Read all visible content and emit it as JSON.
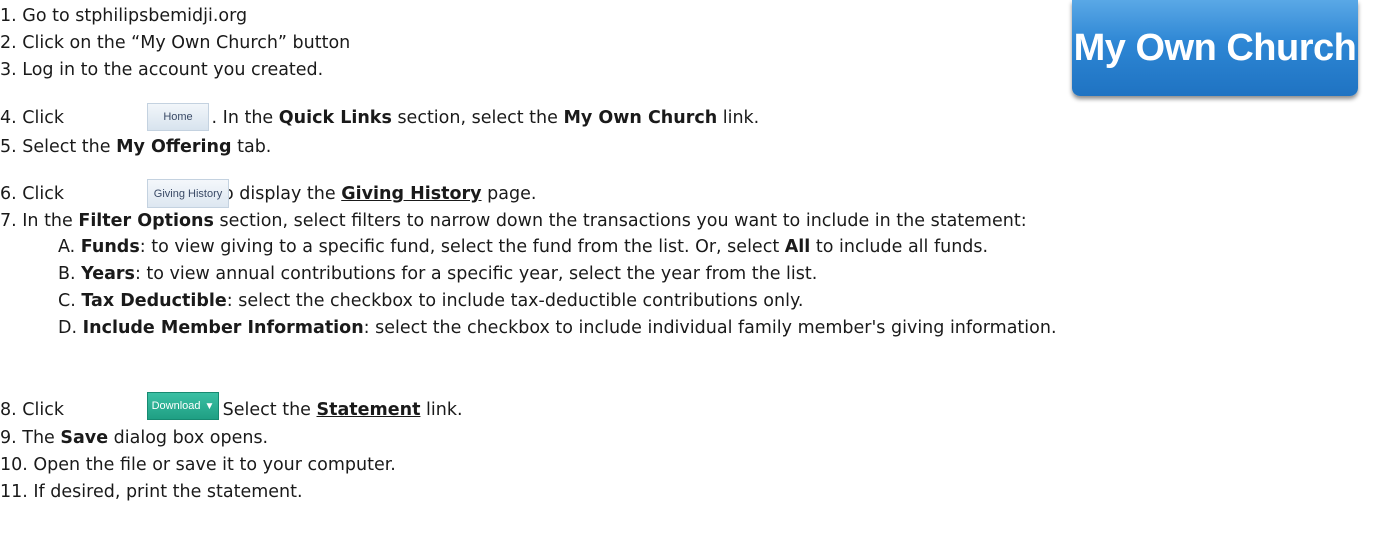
{
  "banner_button": "My Own Church",
  "home_button": "Home",
  "giving_history_button": "Giving History",
  "download_button": "Download",
  "download_arrow": "▼",
  "steps": {
    "s1": "1. Go to stphilipsbemidji.org",
    "s2": "2. Click on the “My Own Church” button",
    "s3": "3. Log in to the account you created.",
    "s4": {
      "a": "4. Click ",
      "b": ". In the ",
      "c": "Quick Links",
      "d": " section, select the ",
      "e": "My Own Church",
      "f": " link."
    },
    "s5": {
      "a": "5. Select the ",
      "b": "My Offering",
      "c": " tab."
    },
    "s6": {
      "a": "6. Click ",
      "b": " to display the ",
      "c": "Giving History",
      "d": " page."
    },
    "s7": {
      "a": "7. In the ",
      "b": "Filter Options",
      "c": " section, select filters to narrow down the transactions you want to include in the statement:"
    },
    "s7a": {
      "a": "A. ",
      "b": "Funds",
      "c": ": to view giving to a specific fund, select the fund from the list. Or, select ",
      "d": "All",
      "e": " to include all funds."
    },
    "s7b": {
      "a": "B. ",
      "b": "Years",
      "c": ": to view annual contributions for a specific year, select the year from the list."
    },
    "s7c": {
      "a": "C. ",
      "b": "Tax Deductible",
      "c": ": select the checkbox to include tax-deductible contributions only."
    },
    "s7d": {
      "a": "D. ",
      "b": "Include Member Information",
      "c": ": select the checkbox to include individual family member's giving information."
    },
    "s8": {
      "a": "8. Click ",
      "b": ". Select the ",
      "c": "Statement",
      "d": " link."
    },
    "s9": {
      "a": "9. The ",
      "b": "Save",
      "c": " dialog box opens."
    },
    "s10": "10. Open the file or save it to your computer.",
    "s11": "11. If desired, print the statement."
  }
}
